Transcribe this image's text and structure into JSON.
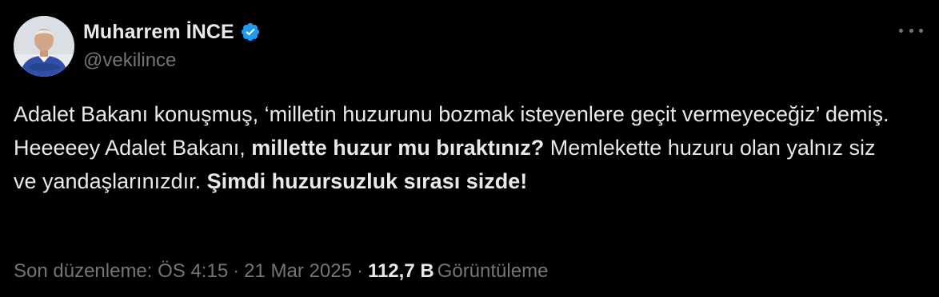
{
  "author": {
    "display_name": "Muharrem İNCE",
    "handle": "@vekilince",
    "verified_icon": "verified-badge-icon",
    "verified_color": "#1d9bf0"
  },
  "tweet": {
    "segments": [
      {
        "text": "Adalet Bakanı konuşmuş, ‘milletin huzurunu bozmak isteyenlere geçit vermeyeceğiz’ demiş. Heeeeey Adalet Bakanı, ",
        "bold": false
      },
      {
        "text": "millette huzur mu bıraktınız?",
        "bold": true
      },
      {
        "text": " Memlekette huzuru olan yalnız siz ve yandaşlarınızdır. ",
        "bold": false
      },
      {
        "text": "Şimdi huzursuzluk sırası sizde!",
        "bold": true
      }
    ]
  },
  "meta": {
    "edited_prefix": "Son düzenleme: ÖS 4:15",
    "separator": "·",
    "date": "21 Mar 2025",
    "views_count": "112,7 B",
    "views_label": "Görüntüleme"
  },
  "colors": {
    "background": "#000000",
    "text": "#e7e9ea",
    "secondary": "#71767b"
  },
  "icons": {
    "more": "more-dots-icon",
    "avatar": "avatar"
  }
}
